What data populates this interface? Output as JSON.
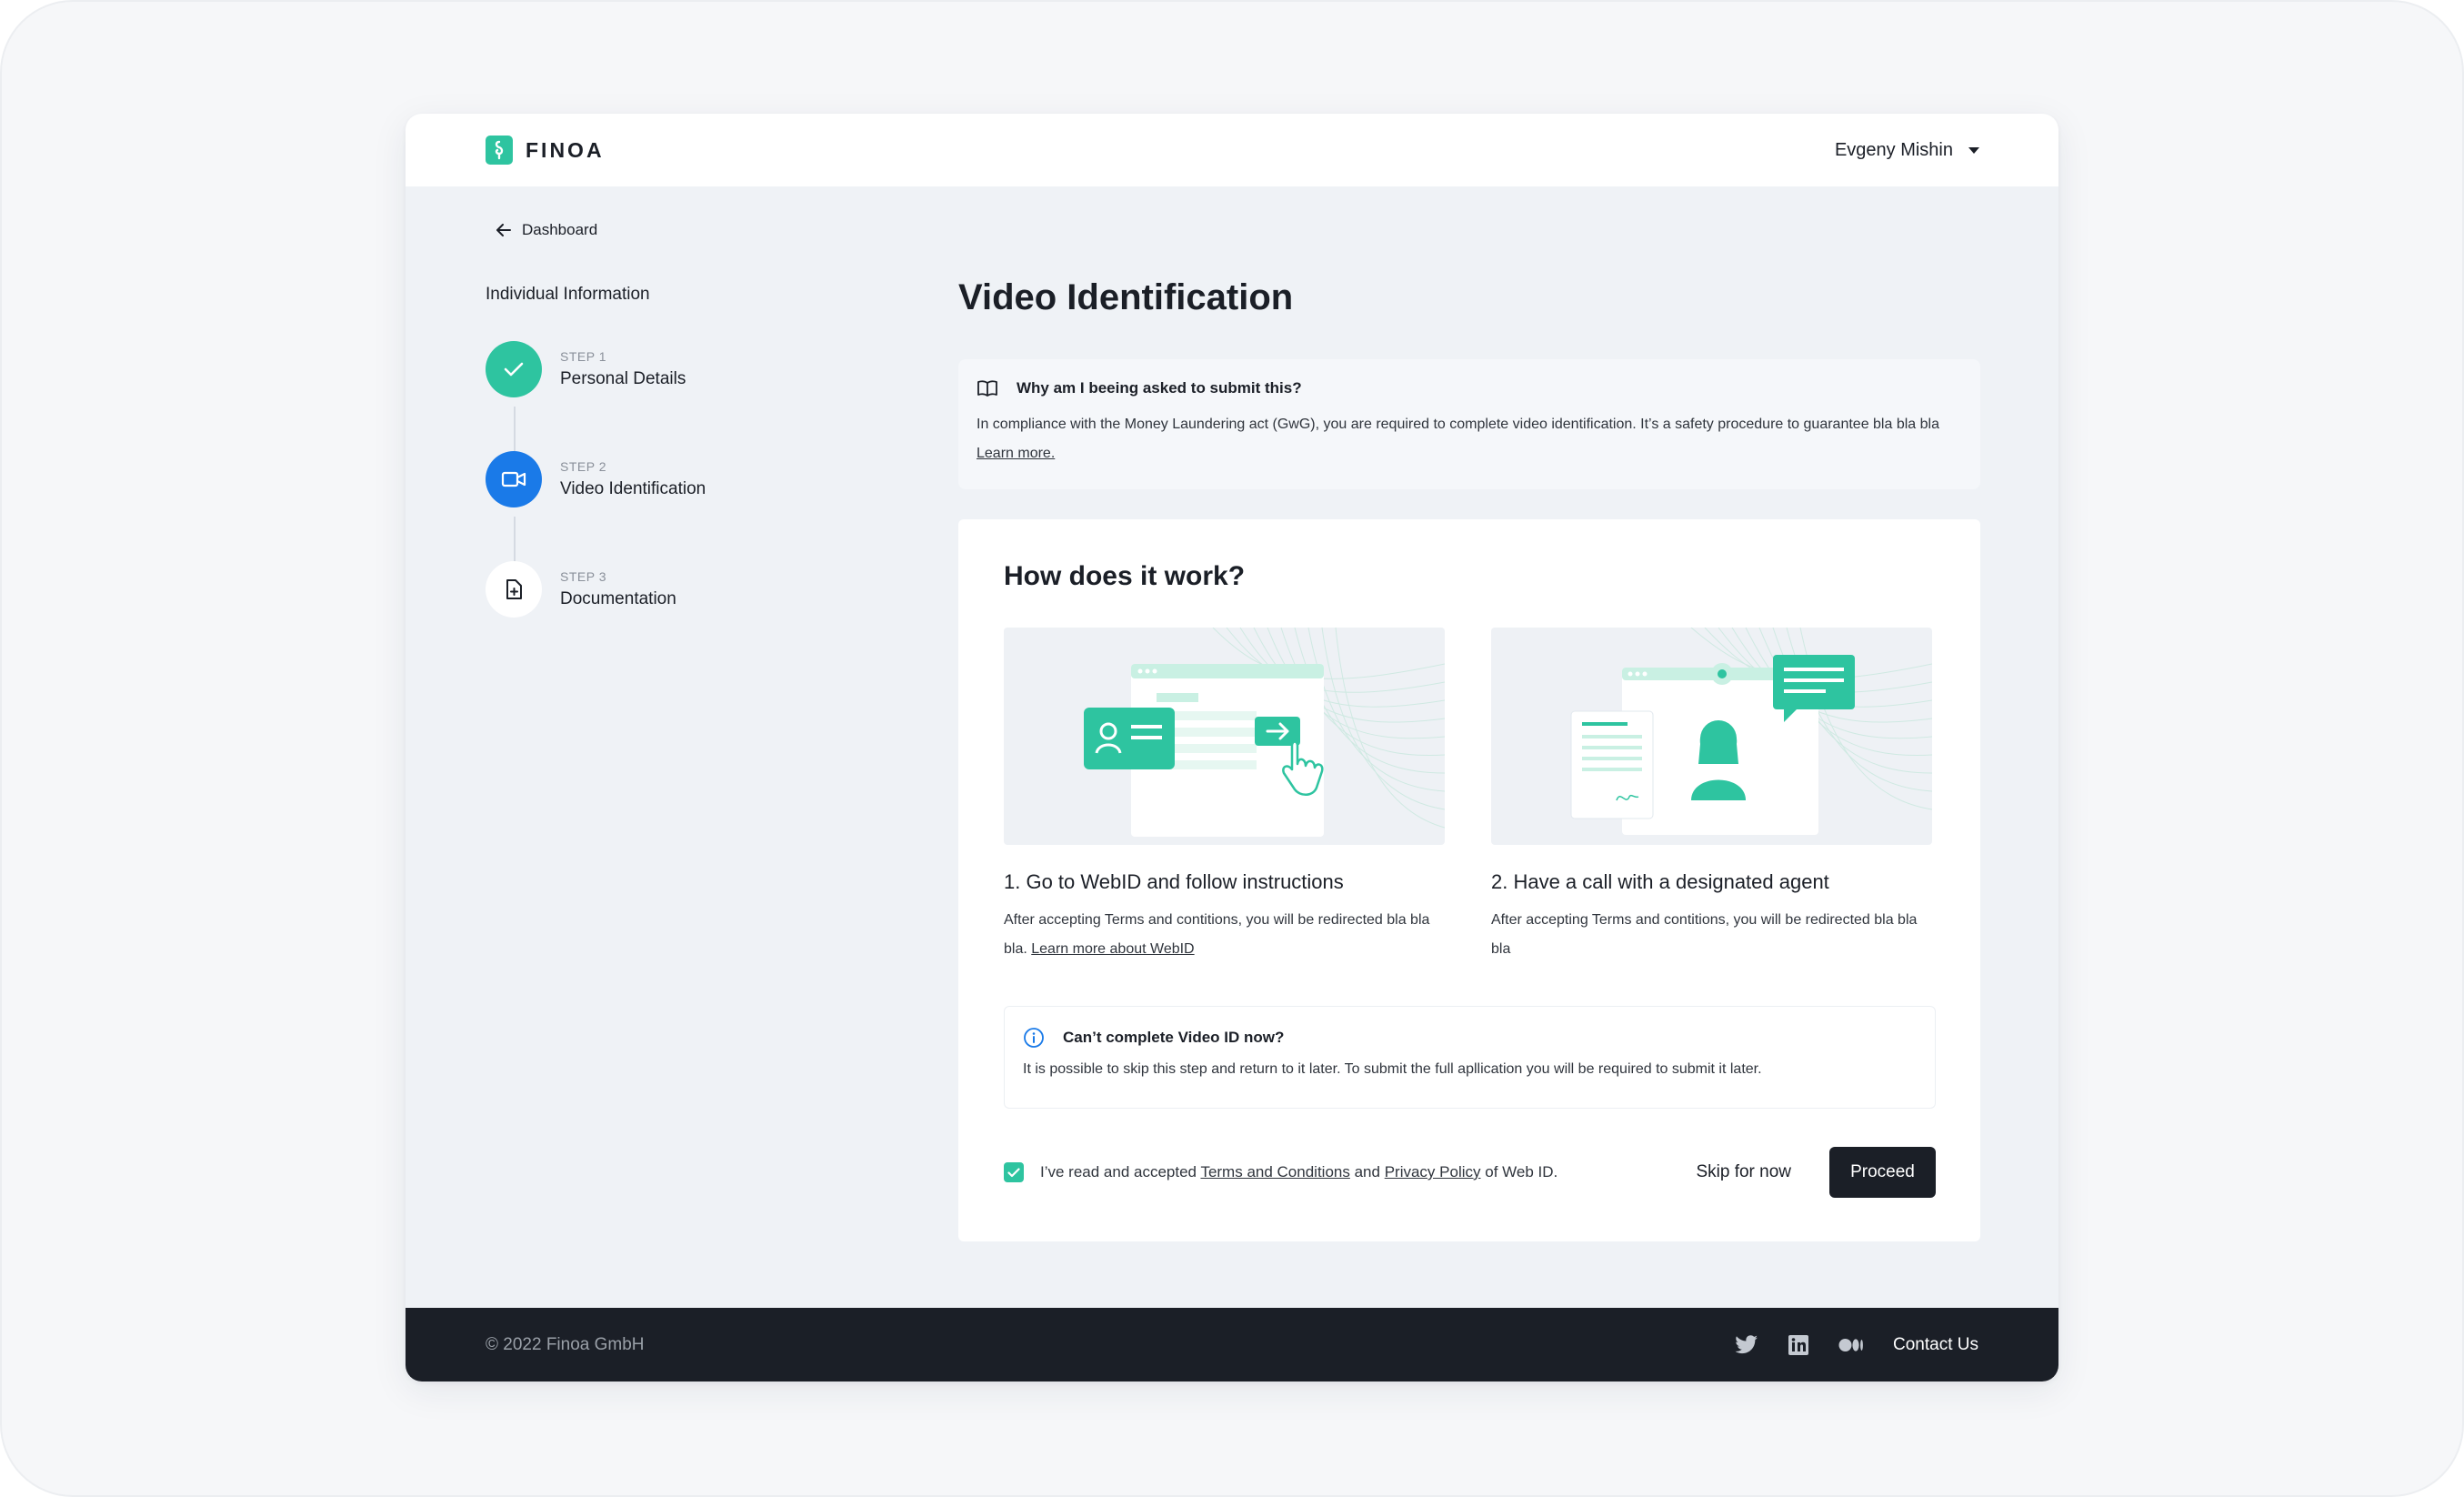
{
  "brand": {
    "name": "FINOA",
    "accent": "#2ec4a0",
    "active": "#1a7ae8",
    "dark": "#1b1f27"
  },
  "header": {
    "user_name": "Evgeny Mishin"
  },
  "nav": {
    "back_label": "Dashboard"
  },
  "sidebar": {
    "title": "Individual Information",
    "steps": [
      {
        "kicker": "STEP 1",
        "label": "Personal Details",
        "status": "done",
        "icon": "check-icon"
      },
      {
        "kicker": "STEP 2",
        "label": "Video Identification",
        "status": "active",
        "icon": "video-camera-icon"
      },
      {
        "kicker": "STEP 3",
        "label": "Documentation",
        "status": "todo",
        "icon": "document-add-icon"
      }
    ]
  },
  "main": {
    "title": "Video Identification",
    "why": {
      "heading": "Why am I beeing asked to submit this?",
      "body": "In compliance with the Money Laundering act (GwG), you are required to complete video identification. It’s a safety procedure to guarantee bla bla bla",
      "link": "Learn more."
    },
    "how": {
      "title": "How does it work?",
      "items": [
        {
          "title": "1. Go to WebID and follow instructions",
          "text": "After accepting Terms and contitions, you will be redirected bla bla bla.",
          "link": "Learn more about WebID"
        },
        {
          "title": "2. Have a call with a designated agent",
          "text": "After accepting Terms and contitions, you will be redirected bla bla bla",
          "link": ""
        }
      ]
    },
    "notice": {
      "heading": "Can’t complete Video ID now?",
      "body": "It is possible to skip this step and return to it later. To submit the full apllication you will be required to submit it later."
    },
    "consent": {
      "checked": true,
      "prefix": "I’ve read and accepted",
      "terms_link": "Terms and Conditions",
      "and": "and",
      "privacy_link": "Privacy Policy",
      "suffix": "of Web ID."
    },
    "actions": {
      "skip_label": "Skip for now",
      "proceed_label": "Proceed"
    }
  },
  "footer": {
    "copyright": "© 2022 Finoa GmbH",
    "social": [
      "twitter-icon",
      "linkedin-icon",
      "medium-icon"
    ],
    "contact_label": "Contact Us"
  }
}
